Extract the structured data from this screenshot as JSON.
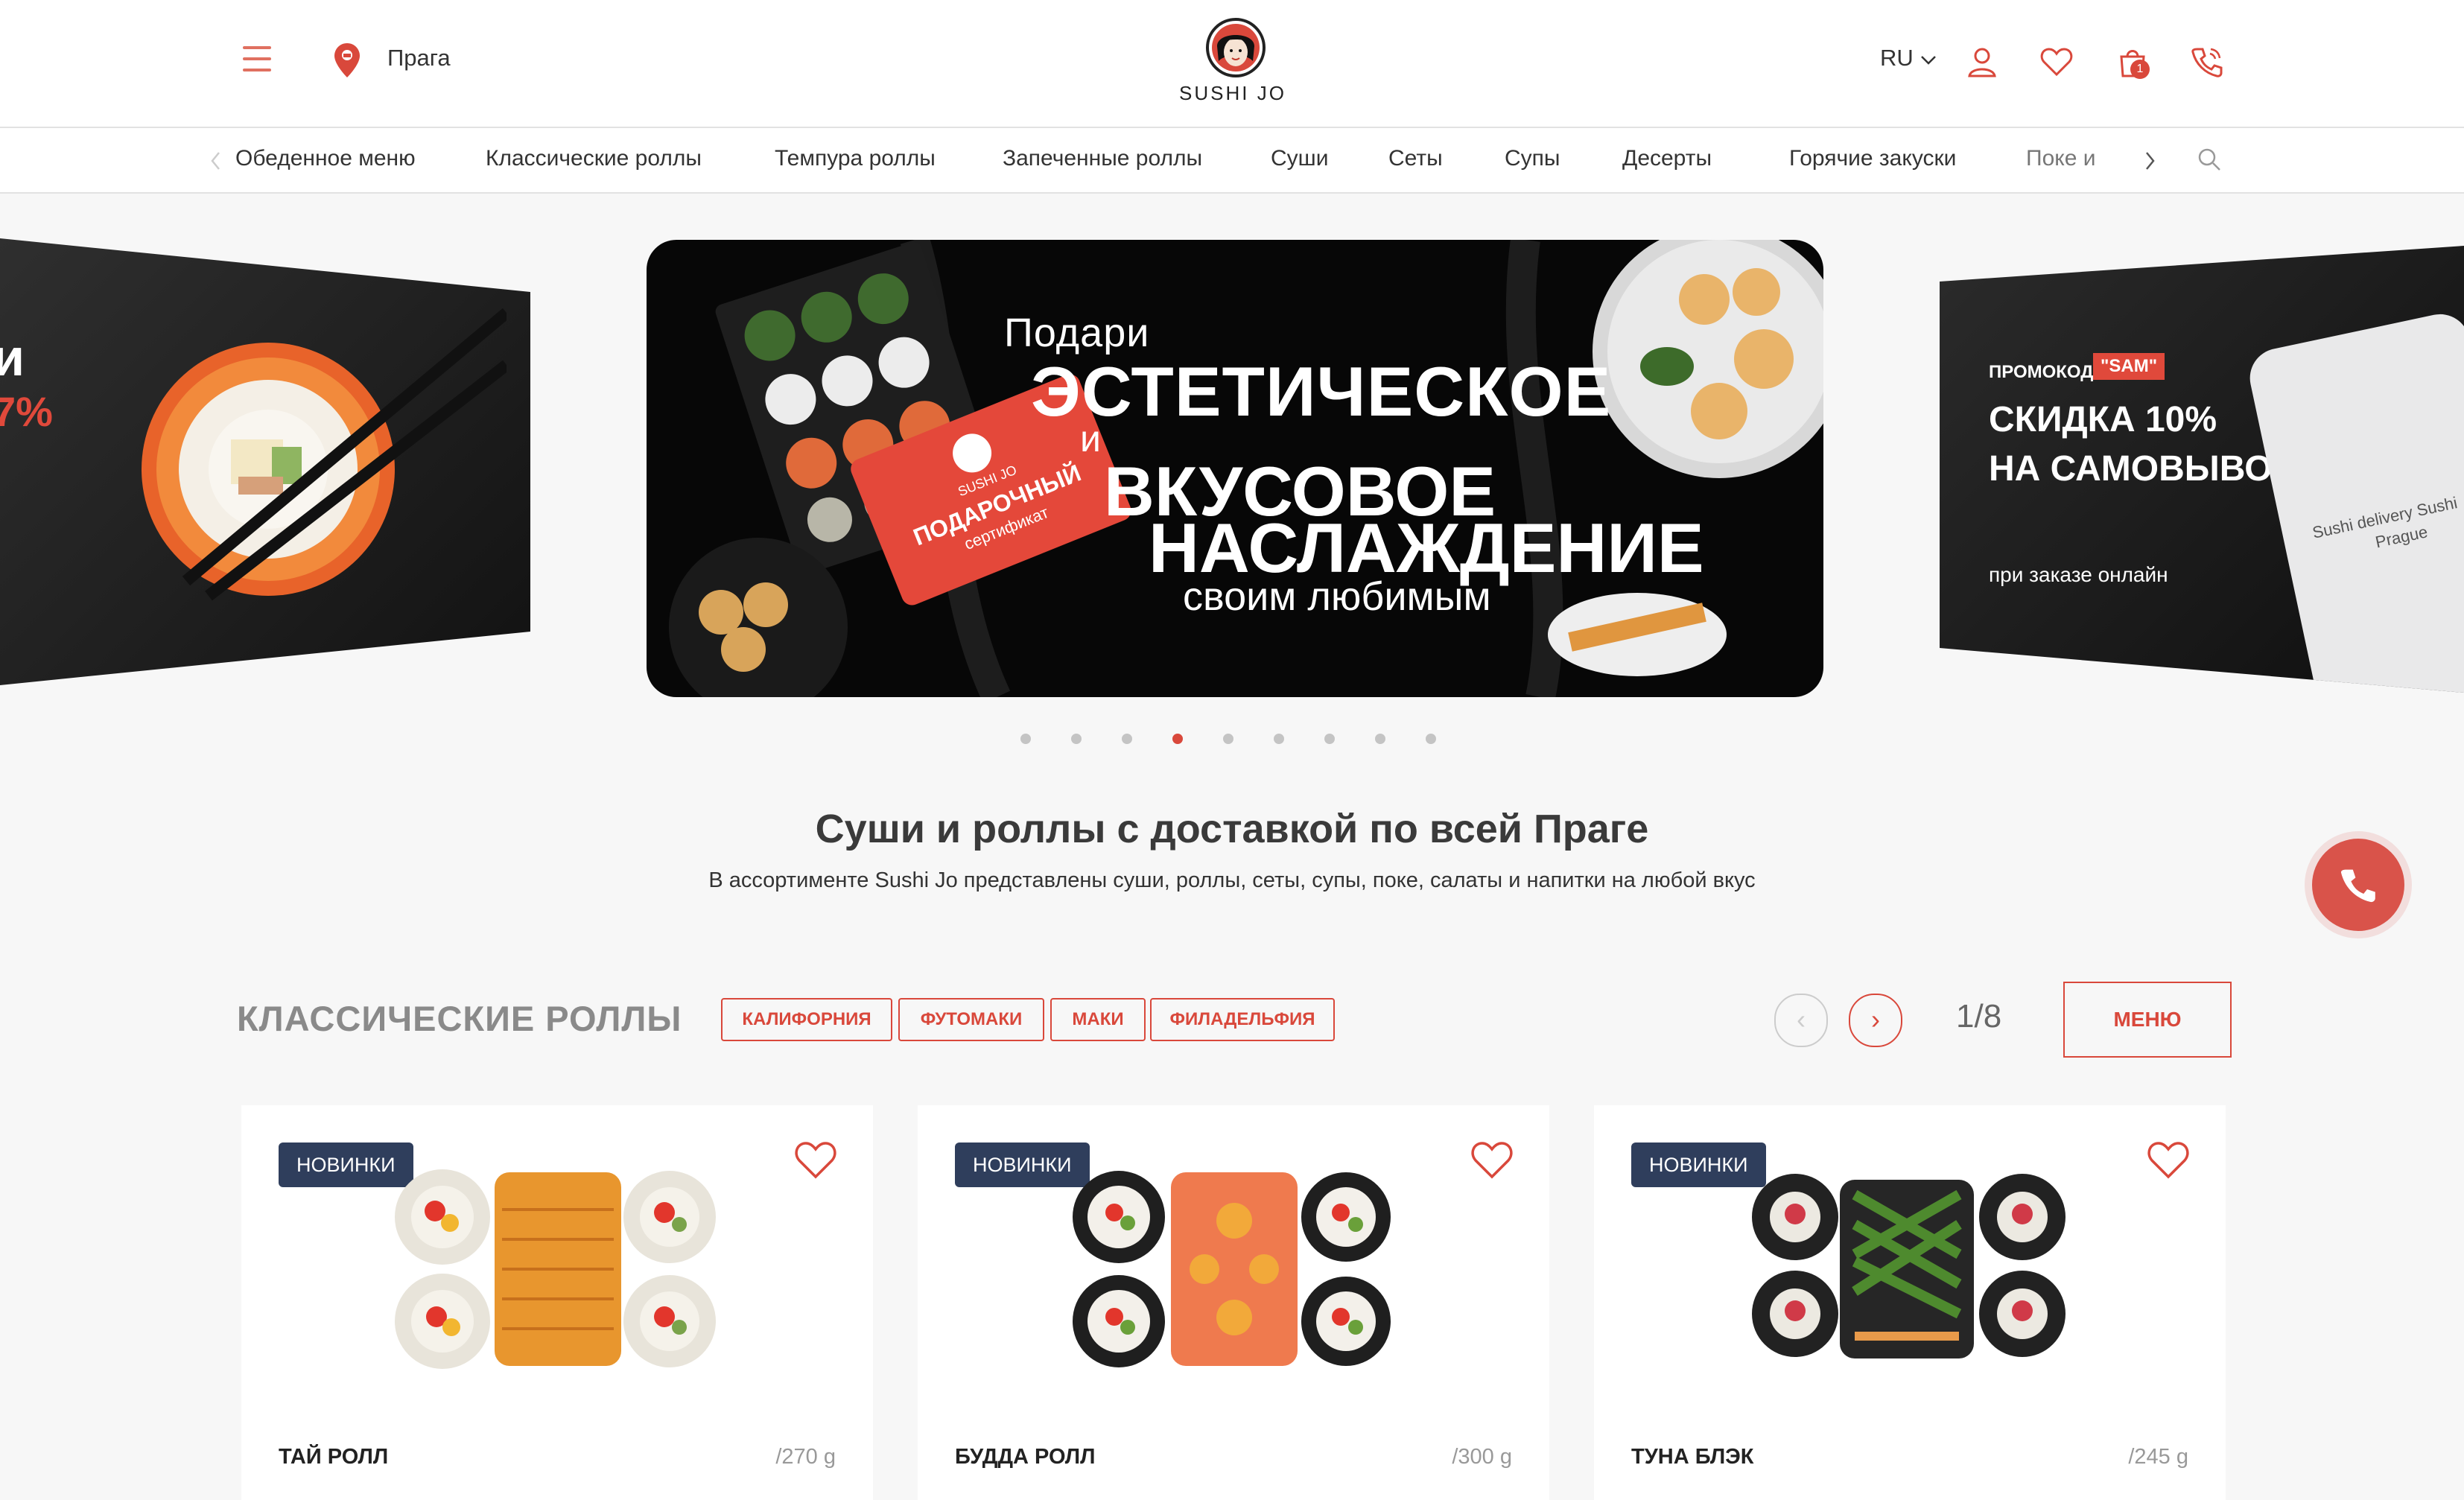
{
  "header": {
    "city": "Прага",
    "logo_text": "SUSHI JO",
    "lang": "RU",
    "cart_count": "1"
  },
  "nav": {
    "items": [
      "Обеденное меню",
      "Классические роллы",
      "Темпура роллы",
      "Запеченные роллы",
      "Суши",
      "Сеты",
      "Супы",
      "Десерты",
      "Горячие закуски",
      "Поке и"
    ]
  },
  "hero": {
    "left_partial_title": "и",
    "left_partial_discount": "7%",
    "main": {
      "line1": "Подари",
      "line2": "ЭСТЕТИЧЕСКОЕ",
      "line3": "и",
      "line4": "ВКУСОВОЕ",
      "line5": "НАСЛАЖДЕНИЕ",
      "line6": "своим любимым",
      "card_brand": "SUSHI JO",
      "card_title": "ПОДАРОЧНЫЙ",
      "card_sub": "сертификат"
    },
    "right": {
      "promo_label": "ПРОМОКОД",
      "promo_code": "\"SAM\"",
      "line1": "СКИДКА 10%",
      "line2": "НА САМОВЫВОЗ",
      "line3": "при заказе онлайн",
      "phone_text1": "Sushi delivery Sushi",
      "phone_text2": "Prague"
    },
    "dots_total": 9,
    "active_dot": 4
  },
  "intro": {
    "title": "Суши и роллы с доставкой по всей Праге",
    "subtitle": "В ассортименте Sushi Jo представлены суши, роллы, сеты, супы, поке, салаты и напитки на любой вкус"
  },
  "section": {
    "title": "КЛАССИЧЕСКИЕ РОЛЛЫ",
    "tags": [
      "КАЛИФОРНИЯ",
      "ФУТОМАКИ",
      "МАКИ",
      "ФИЛАДЕЛЬФИЯ"
    ],
    "pager": "1/8",
    "menu_button": "МЕНЮ"
  },
  "products": [
    {
      "badge": "НОВИНКИ",
      "name": "ТАЙ РОЛЛ",
      "weight": "/270 g"
    },
    {
      "badge": "НОВИНКИ",
      "name": "БУДДА РОЛЛ",
      "weight": "/300 g"
    },
    {
      "badge": "НОВИНКИ",
      "name": "ТУНА БЛЭК",
      "weight": "/245 g"
    }
  ],
  "colors": {
    "accent": "#d9483b",
    "badge": "#2f3e5c"
  }
}
